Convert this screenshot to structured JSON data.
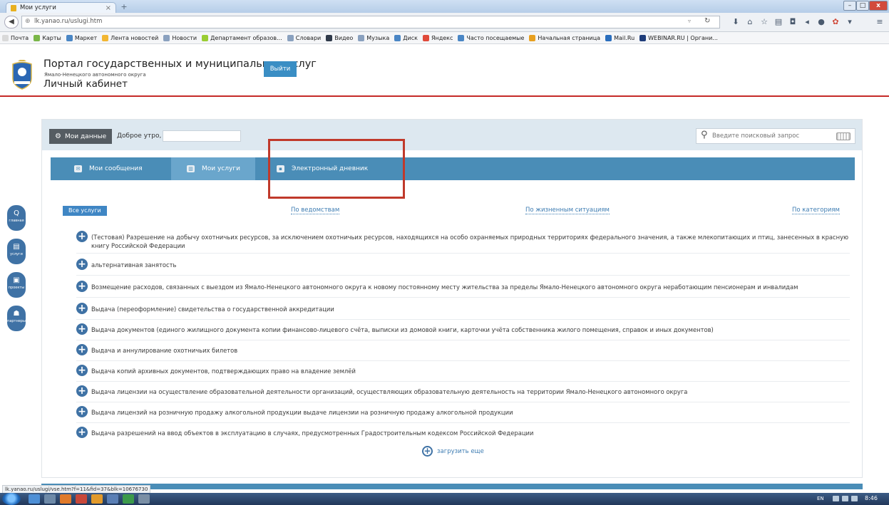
{
  "browser": {
    "tab_title": "Мои услуги",
    "tab_close": "×",
    "new_tab": "+",
    "url": "lk.yanao.ru/uslugi.htm",
    "window_buttons": {
      "minimize": "–",
      "maximize": "□",
      "close": "x"
    },
    "back": "◀",
    "bookmarks": [
      {
        "label": "Почта",
        "color": "#d9d9d9"
      },
      {
        "label": "Карты",
        "color": "#7ab648"
      },
      {
        "label": "Маркет",
        "color": "#4a86c5"
      },
      {
        "label": "Лента новостей",
        "color": "#f2b632"
      },
      {
        "label": "Новости",
        "color": "#8aa1bf"
      },
      {
        "label": "Департамент образов...",
        "color": "#9acd32"
      },
      {
        "label": "Словари",
        "color": "#8aa1bf"
      },
      {
        "label": "Видео",
        "color": "#2f3a4a"
      },
      {
        "label": "Музыка",
        "color": "#8aa1bf"
      },
      {
        "label": "Диск",
        "color": "#4a86c5"
      },
      {
        "label": "Яндекс",
        "color": "#e04a3a"
      },
      {
        "label": "Часто посещаемые",
        "color": "#4a86c5"
      },
      {
        "label": "Начальная страница",
        "color": "#e8a020"
      },
      {
        "label": "Mail.Ru",
        "color": "#2a6ebd"
      },
      {
        "label": "WEBINAR.RU | Органи...",
        "color": "#1f3d7a"
      }
    ]
  },
  "header": {
    "title": "Портал государственных и муниципальных услуг",
    "subtitle": "Ямало-Ненецкого автономного округа",
    "cabinet": "Личный кабинет",
    "logout": "Выйти"
  },
  "topbar": {
    "my_data": "Мои данные",
    "greeting": "Доброе утро,",
    "search_placeholder": "Введите поисковый запрос"
  },
  "tabs": {
    "messages": "Мои сообщения",
    "services": "Мои услуги",
    "diary": "Электронный дневник"
  },
  "filters": {
    "all": "Все услуги",
    "by_department": "По ведомствам",
    "by_life": "По жизненным ситуациям",
    "by_category": "По категориям"
  },
  "services": [
    "(Тестовая) Разрешение на добычу охотничьих ресурсов, за исключением охотничьих ресурсов, находящихся на особо охраняемых природных территориях федерального значения, а также млекопитающих и птиц, занесенных в красную книгу Российской Федерации",
    "альтернативная занятость",
    "Возмещение расходов, связанных с выездом из Ямало-Ненецкого автономного округа к новому постоянному месту жительства за пределы Ямало-Ненецкого автономного округа неработающим пенсионерам и инвалидам",
    "Выдача (переоформление) свидетельства о государственной аккредитации",
    "Выдача документов (единого жилищного документа копии финансово-лицевого счёта, выписки из домовой книги, карточки учёта собственника жилого помещения, справок и иных документов)",
    "Выдача и аннулирование охотничьих билетов",
    "Выдача копий архивных документов, подтверждающих право на владение землёй",
    "Выдача лицензии на осуществление образовательной деятельности организаций, осуществляющих образовательную деятельность на территории Ямало-Ненецкого автономного округа",
    "Выдача лицензий на розничную продажу алкогольной продукции выдаче лицензии на розничную продажу алкогольной продукции",
    "Выдача разрешений на ввод объектов в эксплуатацию в случаях, предусмотренных Градостроительным кодексом Российской Федерации"
  ],
  "load_more": "загрузить еще",
  "sidenav": [
    {
      "label": "главная",
      "icon": "Q"
    },
    {
      "label": "услуги",
      "icon": "▤"
    },
    {
      "label": "проекты",
      "icon": "▣"
    },
    {
      "label": "партнеры",
      "icon": "☗"
    }
  ],
  "status_url": "lk.yanao.ru/uslugi/vse.htm?f=11&fid=37&blk=10676730",
  "tray": {
    "lang": "EN",
    "time": "8:46"
  }
}
